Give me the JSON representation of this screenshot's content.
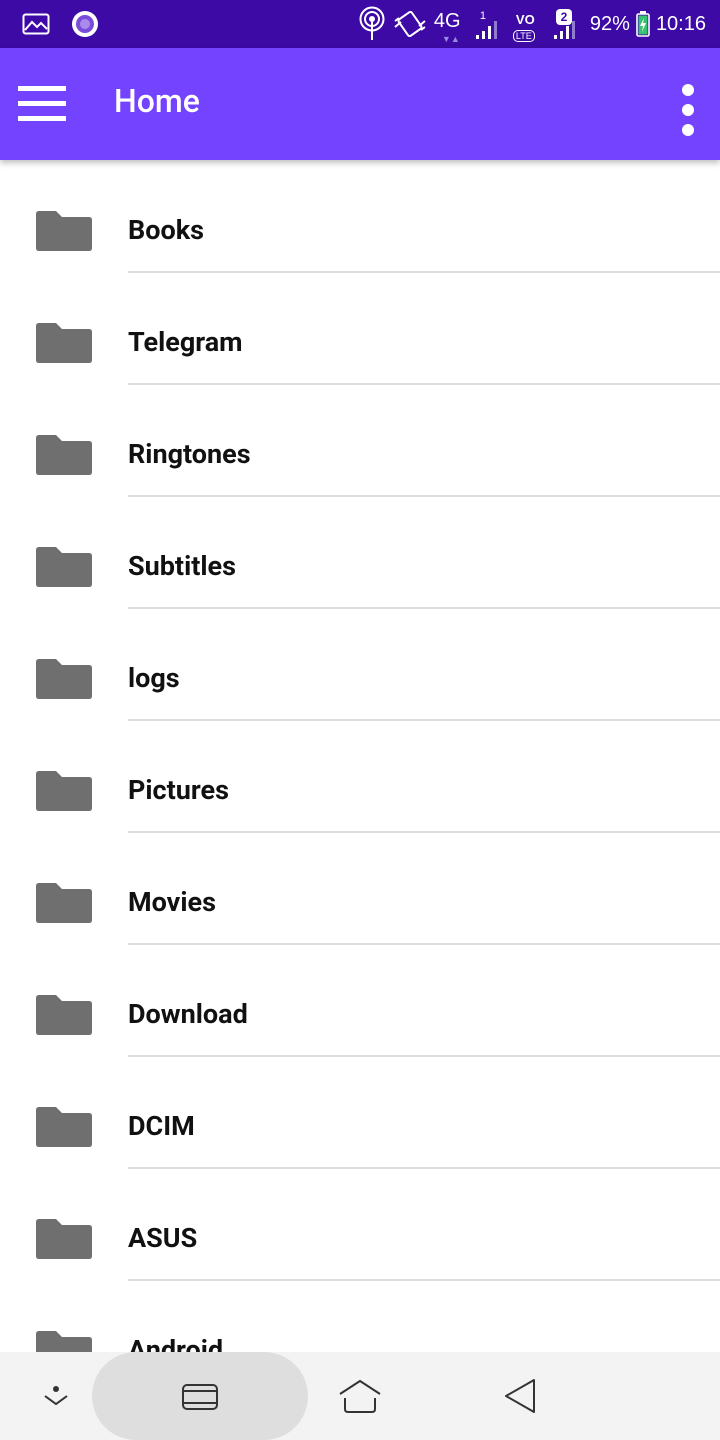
{
  "status_bar": {
    "network": "4G",
    "sim1_label": "1",
    "volte_label": "VO",
    "lte_label": "LTE",
    "sim2_label": "2",
    "battery": "92%",
    "time": "10:16"
  },
  "app_bar": {
    "title": "Home"
  },
  "folders": [
    {
      "name": "Books"
    },
    {
      "name": "Telegram"
    },
    {
      "name": "Ringtones"
    },
    {
      "name": "Subtitles"
    },
    {
      "name": "logs"
    },
    {
      "name": "Pictures"
    },
    {
      "name": "Movies"
    },
    {
      "name": "Download"
    },
    {
      "name": "DCIM"
    },
    {
      "name": "ASUS"
    },
    {
      "name": "Android"
    }
  ],
  "colors": {
    "status_bar": "#3d0aa6",
    "app_bar": "#7443ff",
    "folder_icon": "#6f6f6f",
    "divider": "#dddddd",
    "nav_bar": "#f3f3f3"
  },
  "icons": {
    "menu": "hamburger-menu-icon",
    "more": "more-vert-icon",
    "folder": "folder-icon",
    "nav_down": "chevron-down-icon",
    "nav_recents": "recents-icon",
    "nav_home": "home-icon",
    "nav_back": "back-icon"
  }
}
